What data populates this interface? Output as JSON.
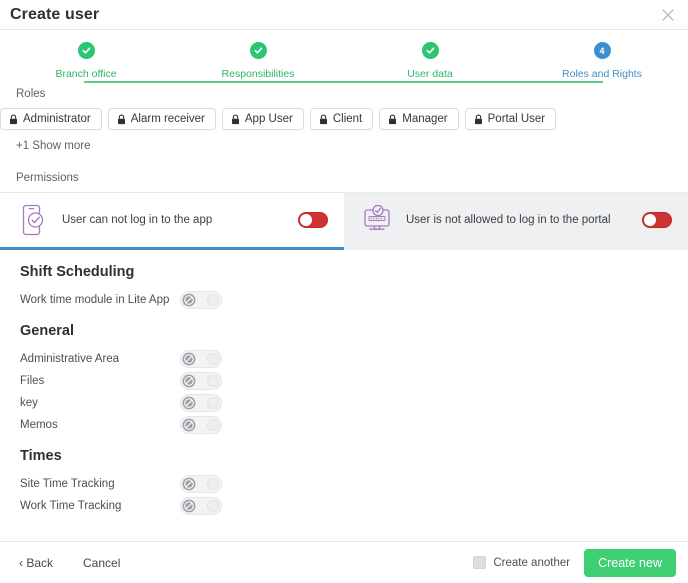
{
  "header": {
    "title": "Create user",
    "close_icon": "close-icon"
  },
  "stepper": {
    "steps": [
      {
        "label": "Branch office",
        "state": "complete",
        "marker": "check-icon"
      },
      {
        "label": "Responsibilities",
        "state": "complete",
        "marker": "check-icon"
      },
      {
        "label": "User data",
        "state": "complete",
        "marker": "check-icon"
      },
      {
        "label": "Roles and Rights",
        "state": "current",
        "marker": "4"
      }
    ]
  },
  "roles": {
    "label": "Roles",
    "chips": [
      {
        "label": "Administrator",
        "icon": "lock-icon"
      },
      {
        "label": "Alarm receiver",
        "icon": "lock-icon"
      },
      {
        "label": "App User",
        "icon": "lock-icon"
      },
      {
        "label": "Client",
        "icon": "lock-icon"
      },
      {
        "label": "Manager",
        "icon": "lock-icon"
      },
      {
        "label": "Portal User",
        "icon": "lock-icon"
      }
    ],
    "show_more": "+1 Show more"
  },
  "permissions": {
    "label": "Permissions",
    "tabs": [
      {
        "text": "User can not log in to the app",
        "icon": "mobile-check-icon",
        "active": true,
        "toggle_state": "off"
      },
      {
        "text": "User is not allowed to log in to the portal",
        "icon": "monitor-check-icon",
        "active": false,
        "toggle_state": "off"
      }
    ],
    "groups": [
      {
        "title": "Shift Scheduling",
        "rows": [
          {
            "label": "Work time module in Lite App",
            "toggle_state": "disabled-blocked"
          }
        ]
      },
      {
        "title": "General",
        "rows": [
          {
            "label": "Administrative Area",
            "toggle_state": "disabled-blocked"
          },
          {
            "label": "Files",
            "toggle_state": "disabled-blocked"
          },
          {
            "label": "key",
            "toggle_state": "disabled-blocked"
          },
          {
            "label": "Memos",
            "toggle_state": "disabled-blocked"
          }
        ]
      },
      {
        "title": "Times",
        "rows": [
          {
            "label": "Site Time Tracking",
            "toggle_state": "disabled-blocked"
          },
          {
            "label": "Work Time Tracking",
            "toggle_state": "disabled-blocked"
          }
        ]
      }
    ]
  },
  "footer": {
    "back_label": "‹ Back",
    "cancel_label": "Cancel",
    "create_another_label": "Create another",
    "create_another_checked": false,
    "primary_label": "Create new"
  },
  "colors": {
    "step_complete": "#28c76f",
    "step_current": "#3a8fd0",
    "active_tab_underline": "#3d8ecc",
    "toggle_red": "#cf3232",
    "primary_button": "#3fcf73",
    "icon_purple": "#a779c0"
  }
}
